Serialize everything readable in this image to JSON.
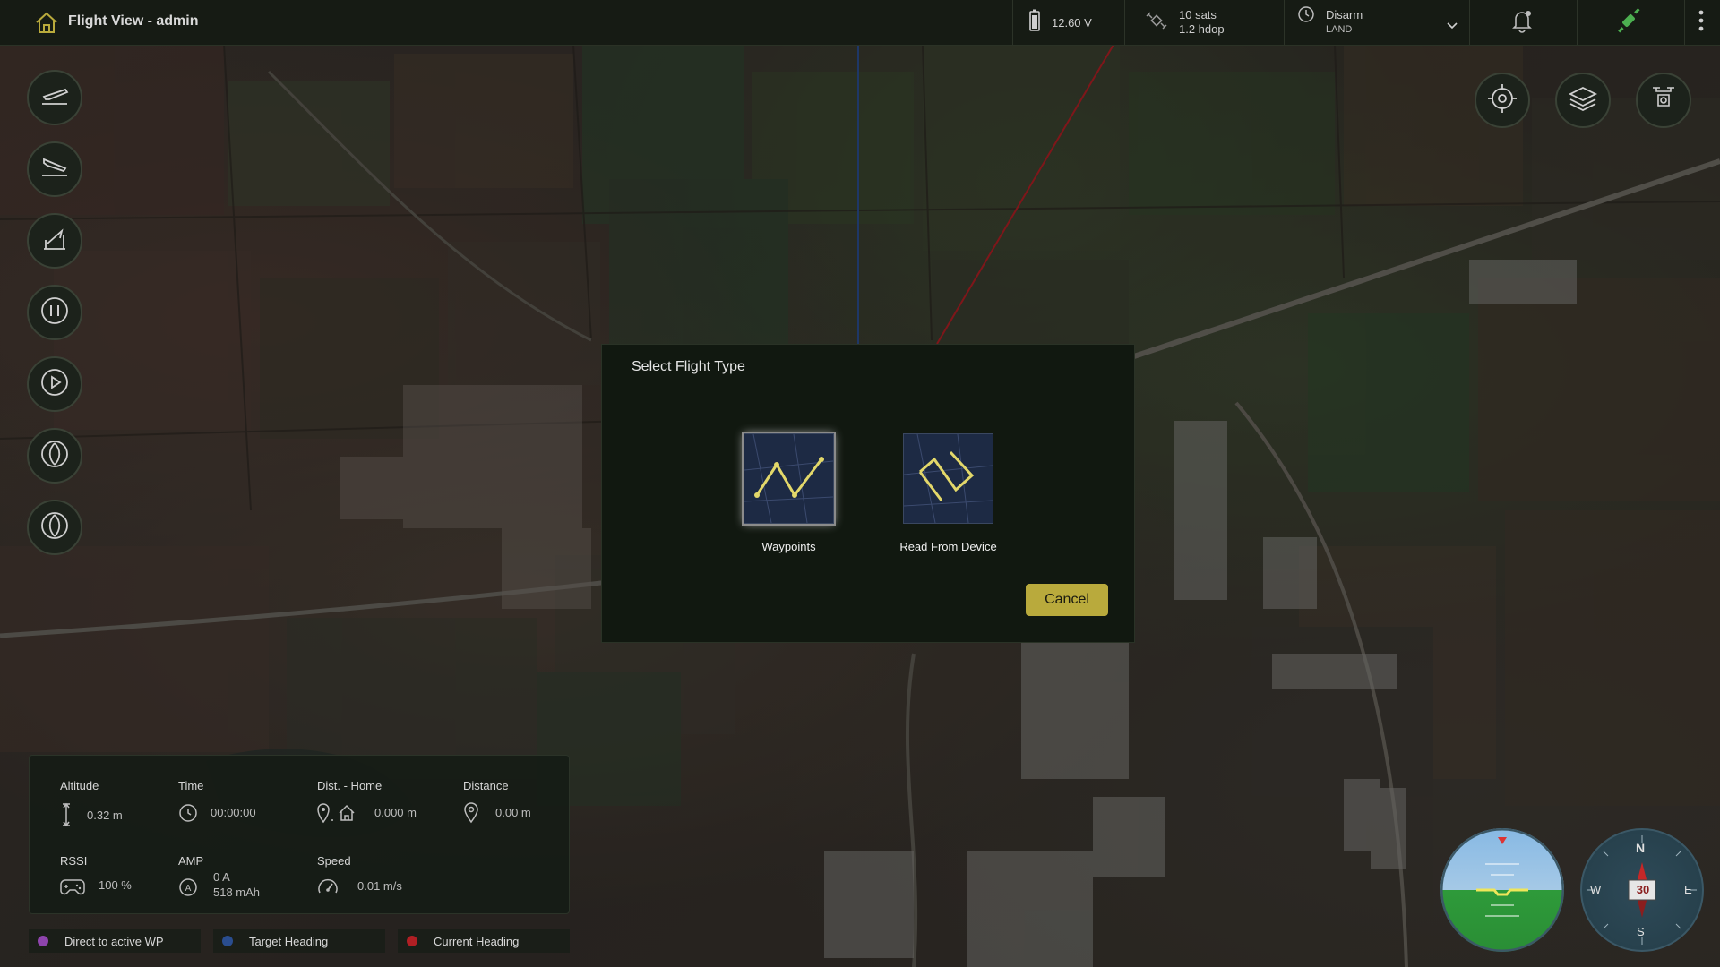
{
  "header": {
    "title": "Flight View - admin",
    "battery": "12.60 V",
    "gps_sats": "10 sats",
    "gps_hdop": "1.2 hdop",
    "arm_state": "Disarm",
    "flight_mode": "LAND"
  },
  "dialog": {
    "title": "Select Flight Type",
    "options": [
      {
        "label": "Waypoints",
        "icon": "zigzag-path-icon",
        "selected": true
      },
      {
        "label": "Read From Device",
        "icon": "loop-path-icon",
        "selected": false
      }
    ],
    "cancel_label": "Cancel"
  },
  "telemetry": {
    "altitude": {
      "label": "Altitude",
      "value": "0.32 m"
    },
    "time": {
      "label": "Time",
      "value": "00:00:00"
    },
    "dist_home": {
      "label": "Dist. - Home",
      "value": "0.000 m"
    },
    "distance": {
      "label": "Distance",
      "value": "0.00 m"
    },
    "rssi": {
      "label": "RSSI",
      "value": "100 %"
    },
    "amp": {
      "label": "AMP",
      "value_current": "0 A",
      "value_capacity": "518 mAh"
    },
    "speed": {
      "label": "Speed",
      "value": "0.01 m/s"
    }
  },
  "legend": [
    {
      "label": "Direct to active WP",
      "color": "#8e44ad"
    },
    {
      "label": "Target Heading",
      "color": "#2a4d8f"
    },
    {
      "label": "Current Heading",
      "color": "#b01f24"
    }
  ],
  "compass": {
    "heading": "30",
    "north": "N",
    "south": "S",
    "east": "E",
    "west": "W"
  },
  "colors": {
    "accent": "#b9aa3c",
    "panel": "#161b14",
    "status_green": "#4caf50"
  }
}
